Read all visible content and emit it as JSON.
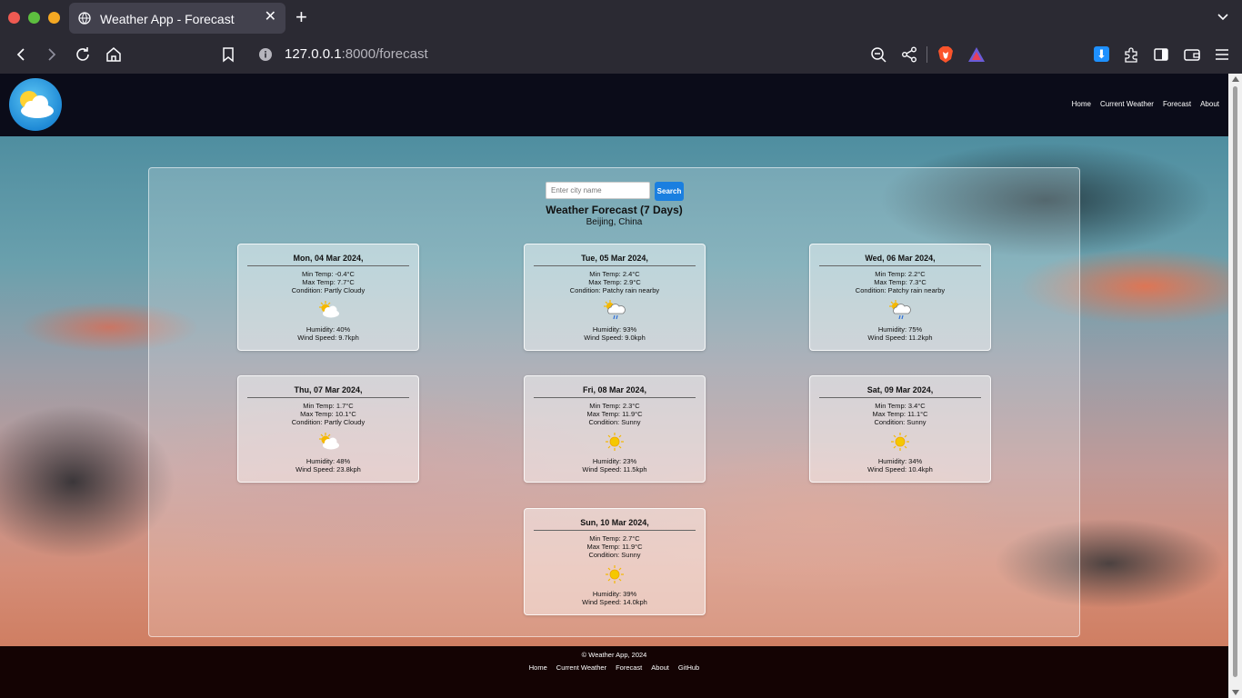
{
  "browser": {
    "tab_title": "Weather App - Forecast",
    "tab_close": "✕",
    "new_tab": "+",
    "url_host": "127.0.0.1",
    "url_rest": ":8000/forecast",
    "download_glyph": "⬇"
  },
  "nav": {
    "items": [
      {
        "label": "Home"
      },
      {
        "label": "Current Weather"
      },
      {
        "label": "Forecast"
      },
      {
        "label": "About"
      }
    ]
  },
  "search": {
    "placeholder": "Enter city name",
    "button_label": "Search"
  },
  "forecast": {
    "title": "Weather Forecast (7 Days)",
    "location": "Beijing, China",
    "days": [
      {
        "date": "Mon, 04 Mar 2024,",
        "min": "Min Temp: -0.4°C",
        "max": "Max Temp: 7.7°C",
        "condition": "Condition: Partly Cloudy",
        "icon": "partly-cloudy",
        "humidity": "Humidity: 40%",
        "wind": "Wind Speed: 9.7kph"
      },
      {
        "date": "Tue, 05 Mar 2024,",
        "min": "Min Temp: 2.4°C",
        "max": "Max Temp: 2.9°C",
        "condition": "Condition: Patchy rain nearby",
        "icon": "patchy-rain",
        "humidity": "Humidity: 93%",
        "wind": "Wind Speed: 9.0kph"
      },
      {
        "date": "Wed, 06 Mar 2024,",
        "min": "Min Temp: 2.2°C",
        "max": "Max Temp: 7.3°C",
        "condition": "Condition: Patchy rain nearby",
        "icon": "patchy-rain",
        "humidity": "Humidity: 75%",
        "wind": "Wind Speed: 11.2kph"
      },
      {
        "date": "Thu, 07 Mar 2024,",
        "min": "Min Temp: 1.7°C",
        "max": "Max Temp: 10.1°C",
        "condition": "Condition: Partly Cloudy",
        "icon": "partly-cloudy",
        "humidity": "Humidity: 48%",
        "wind": "Wind Speed: 23.8kph"
      },
      {
        "date": "Fri, 08 Mar 2024,",
        "min": "Min Temp: 2.3°C",
        "max": "Max Temp: 11.9°C",
        "condition": "Condition: Sunny",
        "icon": "sunny",
        "humidity": "Humidity: 23%",
        "wind": "Wind Speed: 11.5kph"
      },
      {
        "date": "Sat, 09 Mar 2024,",
        "min": "Min Temp: 3.4°C",
        "max": "Max Temp: 11.1°C",
        "condition": "Condition: Sunny",
        "icon": "sunny",
        "humidity": "Humidity: 34%",
        "wind": "Wind Speed: 10.4kph"
      },
      {
        "date": "Sun, 10 Mar 2024,",
        "min": "Min Temp: 2.7°C",
        "max": "Max Temp: 11.9°C",
        "condition": "Condition: Sunny",
        "icon": "sunny",
        "humidity": "Humidity: 39%",
        "wind": "Wind Speed: 14.0kph"
      }
    ]
  },
  "footer": {
    "copyright": "© Weather App, 2024",
    "links": [
      {
        "label": "Home"
      },
      {
        "label": "Current Weather"
      },
      {
        "label": "Forecast"
      },
      {
        "label": "About"
      },
      {
        "label": "GitHub"
      }
    ]
  },
  "colors": {
    "header_bg": "#0b0c19",
    "footer_bg": "#140303",
    "search_button": "#1a7fe0",
    "sun": "#f5b800"
  }
}
